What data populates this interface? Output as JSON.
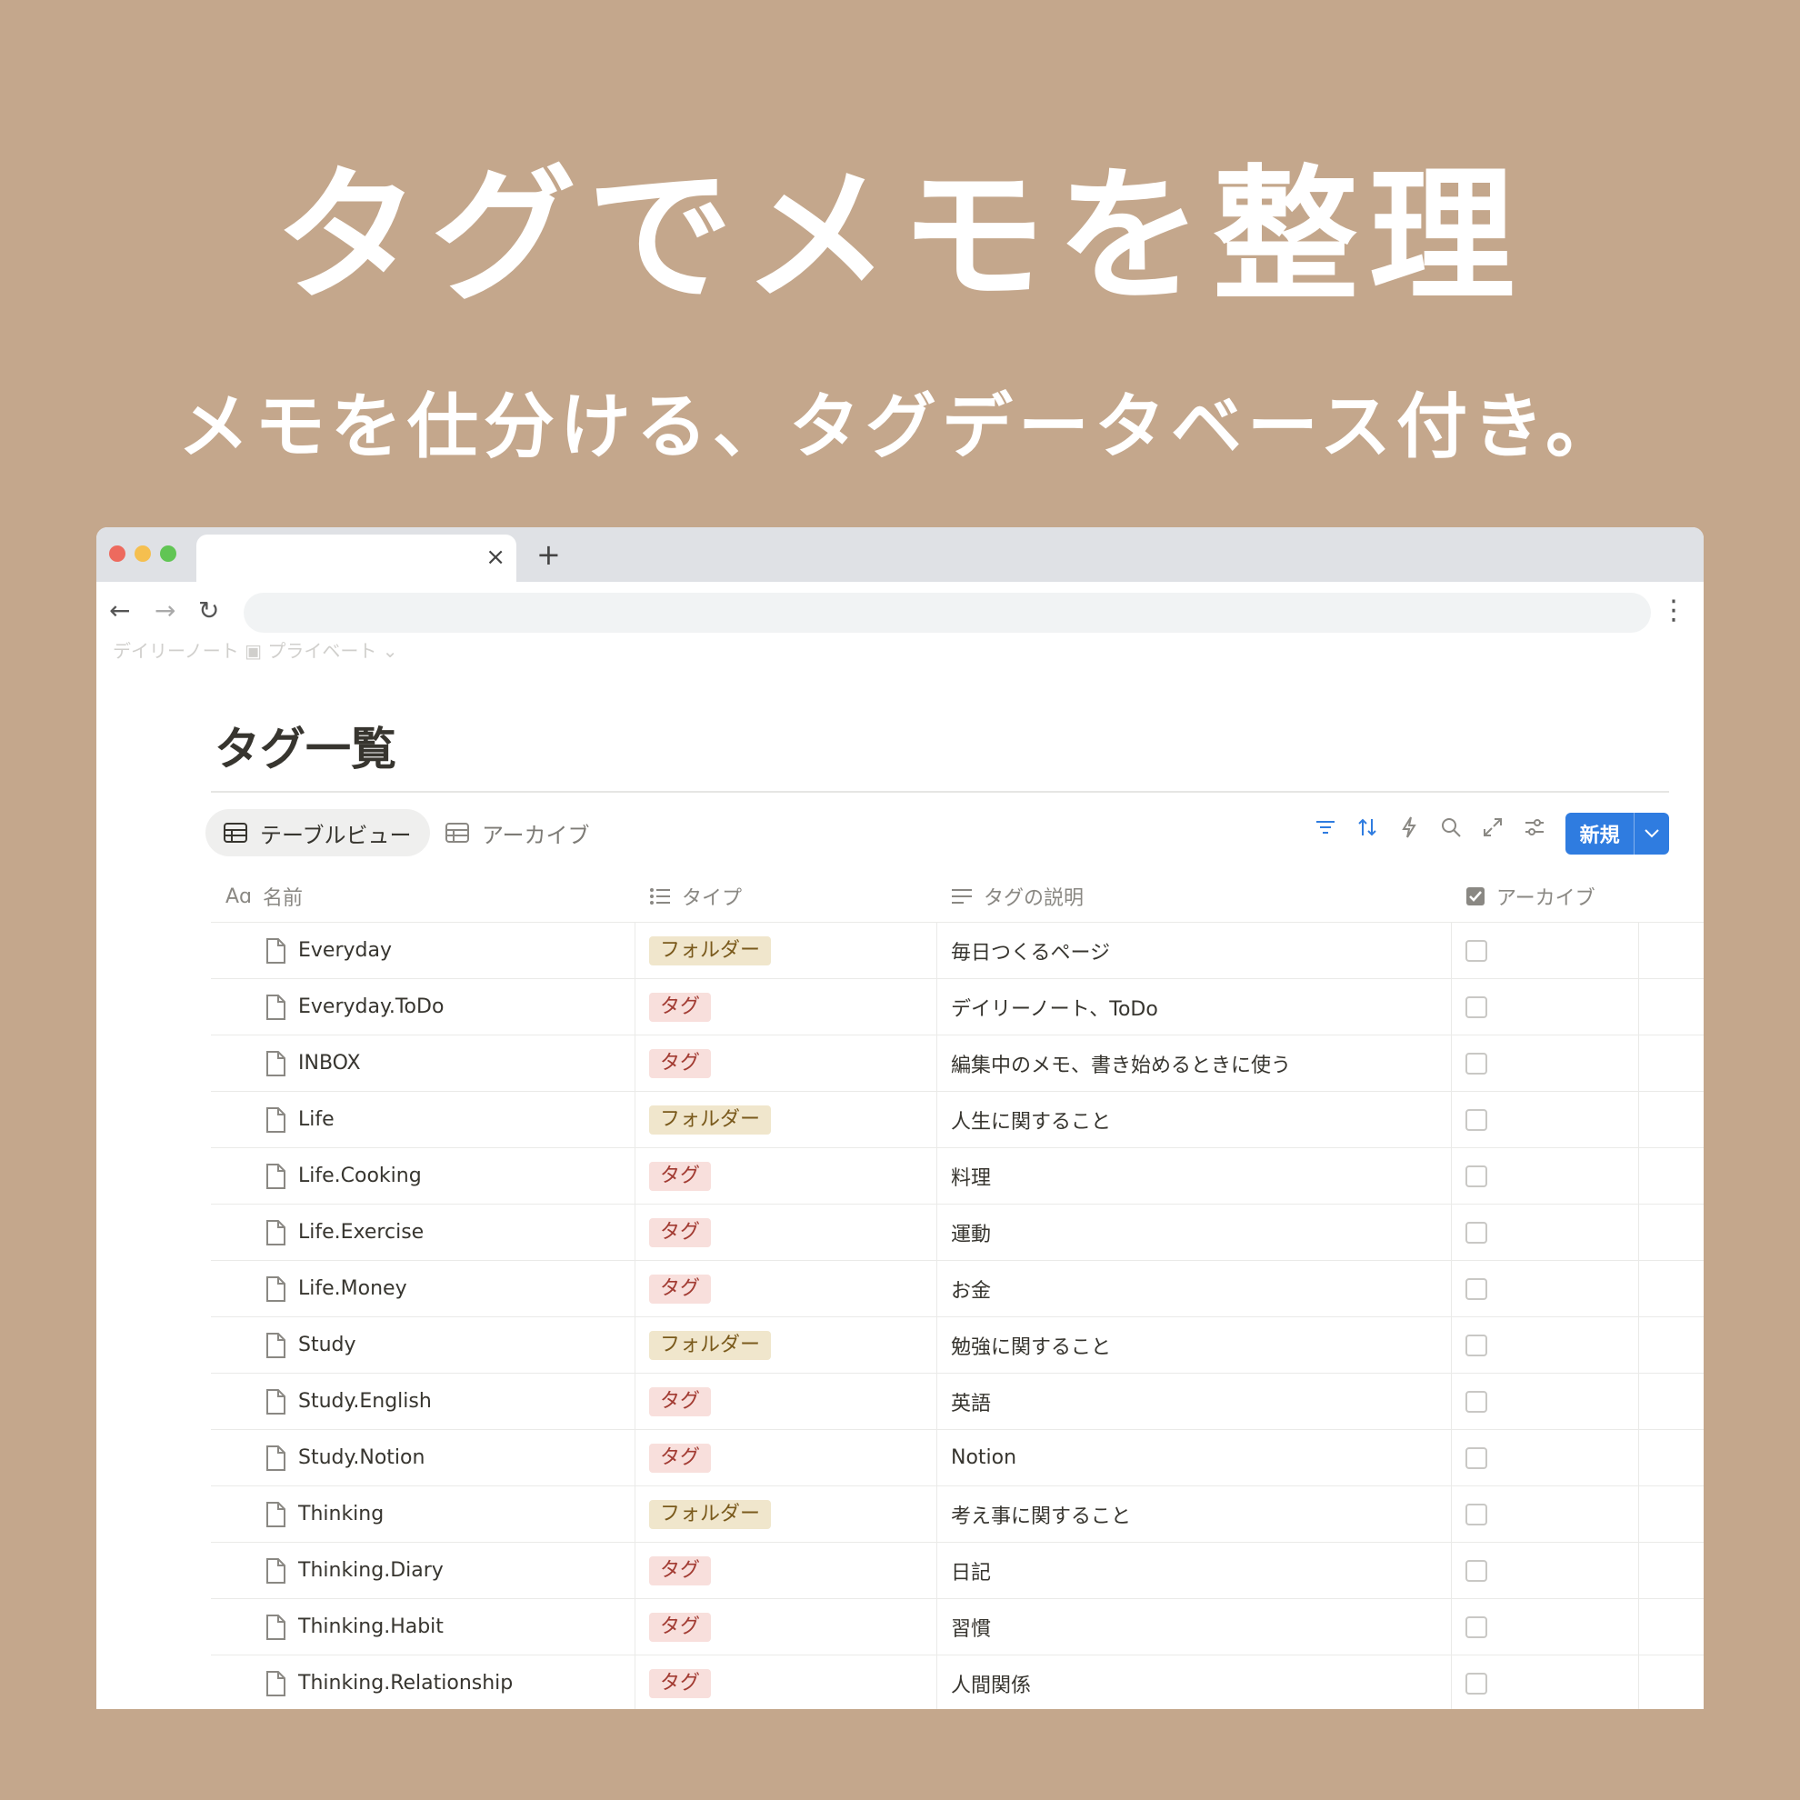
{
  "hero": {
    "title": "タグでメモを整理",
    "subtitle": "メモを仕分ける、タグデータベース付き。"
  },
  "browser": {
    "tab_close": "×",
    "new_tab": "+",
    "back": "←",
    "forward": "→",
    "reload": "↻",
    "menu": "⋮",
    "colors": {
      "close": "#ed6a5e",
      "minimize": "#f5bf4f",
      "zoom": "#61c554"
    }
  },
  "page": {
    "breadcrumb": "デイリーノート  ▣ プライベート ⌄",
    "title": "タグ一覧",
    "views": [
      "テーブルビュー",
      "アーカイブ"
    ],
    "toolbar_icons": [
      "filter-icon",
      "sort-icon",
      "lightning-icon",
      "search-icon",
      "expand-icon",
      "settings-sliders-icon"
    ],
    "new_button": "新規",
    "accent": "#2f7ce0"
  },
  "table": {
    "columns": [
      {
        "label": "名前",
        "icon": "text-type-icon"
      },
      {
        "label": "タイプ",
        "icon": "list-icon"
      },
      {
        "label": "タグの説明",
        "icon": "text-lines-icon"
      },
      {
        "label": "アーカイブ",
        "icon": "checkbox-icon"
      }
    ],
    "add_column": "+",
    "more": "···",
    "rows": [
      {
        "name": "Everyday",
        "type": "フォルダー",
        "kind": "folder",
        "desc": "毎日つくるページ",
        "archived": false
      },
      {
        "name": "Everyday.ToDo",
        "type": "タグ",
        "kind": "tag",
        "desc": "デイリーノート、ToDo",
        "archived": false
      },
      {
        "name": "INBOX",
        "type": "タグ",
        "kind": "tag",
        "desc": "編集中のメモ、書き始めるときに使う",
        "archived": false
      },
      {
        "name": "Life",
        "type": "フォルダー",
        "kind": "folder",
        "desc": "人生に関すること",
        "archived": false
      },
      {
        "name": "Life.Cooking",
        "type": "タグ",
        "kind": "tag",
        "desc": "料理",
        "archived": false
      },
      {
        "name": "Life.Exercise",
        "type": "タグ",
        "kind": "tag",
        "desc": "運動",
        "archived": false
      },
      {
        "name": "Life.Money",
        "type": "タグ",
        "kind": "tag",
        "desc": "お金",
        "archived": false
      },
      {
        "name": "Study",
        "type": "フォルダー",
        "kind": "folder",
        "desc": "勉強に関すること",
        "archived": false
      },
      {
        "name": "Study.English",
        "type": "タグ",
        "kind": "tag",
        "desc": "英語",
        "archived": false
      },
      {
        "name": "Study.Notion",
        "type": "タグ",
        "kind": "tag",
        "desc": "Notion",
        "archived": false
      },
      {
        "name": "Thinking",
        "type": "フォルダー",
        "kind": "folder",
        "desc": "考え事に関すること",
        "archived": false
      },
      {
        "name": "Thinking.Diary",
        "type": "タグ",
        "kind": "tag",
        "desc": "日記",
        "archived": false
      },
      {
        "name": "Thinking.Habit",
        "type": "タグ",
        "kind": "tag",
        "desc": "習慣",
        "archived": false
      },
      {
        "name": "Thinking.Relationship",
        "type": "タグ",
        "kind": "tag",
        "desc": "人間関係",
        "archived": false
      }
    ]
  }
}
